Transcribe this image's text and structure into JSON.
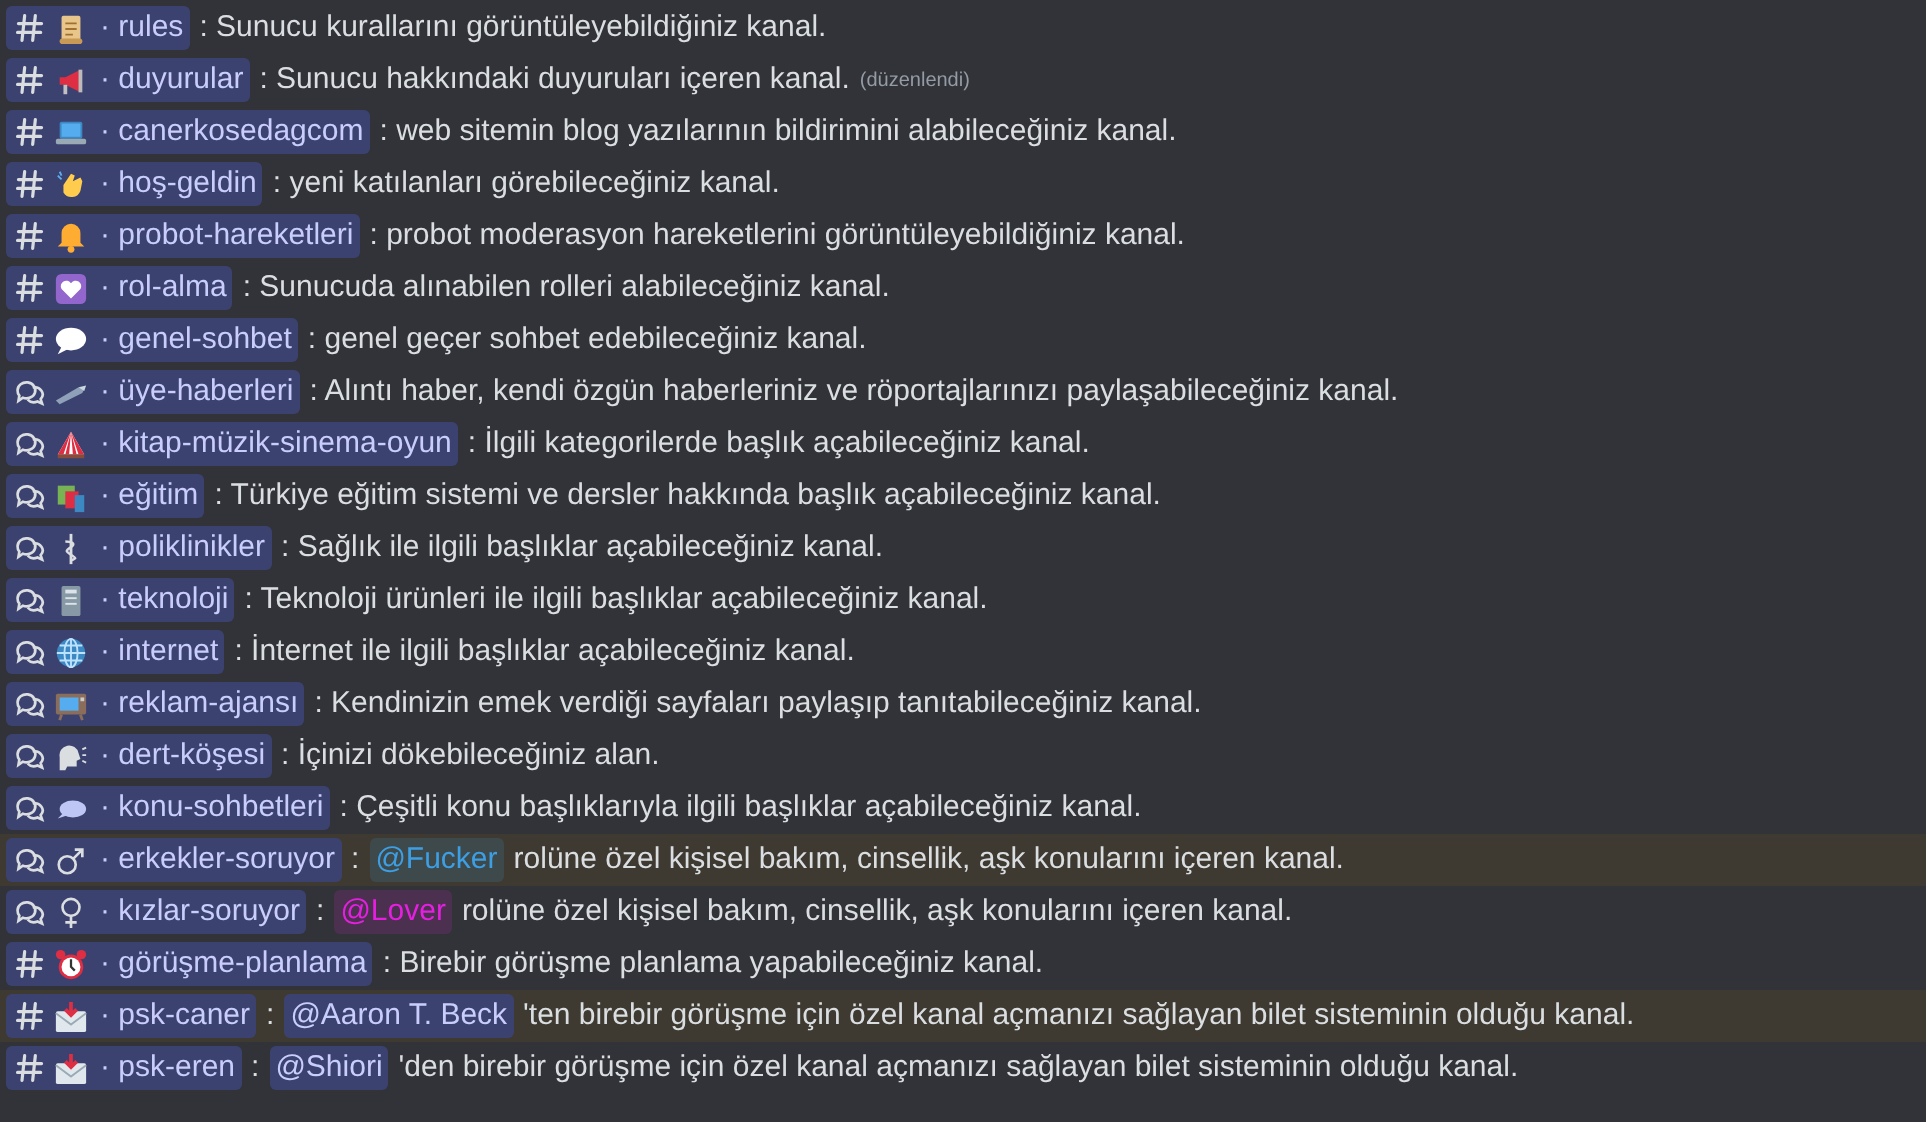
{
  "rows": [
    {
      "channel": {
        "kind": "text",
        "emoji": {
          "kind": "scroll"
        },
        "name": "· rules"
      },
      "parts": [
        {
          "kind": "text",
          "text": ": Sunucu kurallarını görüntüleyebildiğiniz kanal."
        }
      ],
      "highlighted": false
    },
    {
      "channel": {
        "kind": "text",
        "emoji": {
          "kind": "megaphone"
        },
        "name": "· duyurular"
      },
      "parts": [
        {
          "kind": "text",
          "text": ": Sunucu hakkındaki duyuruları içeren kanal."
        }
      ],
      "edited": "(düzenlendi)",
      "highlighted": false
    },
    {
      "channel": {
        "kind": "text",
        "emoji": {
          "kind": "laptop"
        },
        "name": "· canerkosedagcom"
      },
      "parts": [
        {
          "kind": "text",
          "text": ": web sitemin blog yazılarının bildirimini alabileceğiniz kanal."
        }
      ],
      "highlighted": false
    },
    {
      "channel": {
        "kind": "text",
        "emoji": {
          "kind": "hand"
        },
        "name": "· hoş-geldin"
      },
      "parts": [
        {
          "kind": "text",
          "text": ": yeni katılanları görebileceğiniz kanal."
        }
      ],
      "highlighted": false
    },
    {
      "channel": {
        "kind": "text",
        "emoji": {
          "kind": "bell"
        },
        "name": "· probot-hareketleri"
      },
      "parts": [
        {
          "kind": "text",
          "text": ": probot moderasyon hareketlerini görüntüleyebildiğiniz kanal."
        }
      ],
      "highlighted": false
    },
    {
      "channel": {
        "kind": "text",
        "emoji": {
          "kind": "heart"
        },
        "name": "· rol-alma"
      },
      "parts": [
        {
          "kind": "text",
          "text": ": Sunucuda alınabilen rolleri alabileceğiniz kanal."
        }
      ],
      "highlighted": false
    },
    {
      "channel": {
        "kind": "text",
        "emoji": {
          "kind": "speech"
        },
        "name": "· genel-sohbet"
      },
      "parts": [
        {
          "kind": "text",
          "text": ": genel geçer sohbet edebileceğiniz kanal."
        }
      ],
      "highlighted": false
    },
    {
      "channel": {
        "kind": "forum",
        "emoji": {
          "kind": "pen"
        },
        "name": "· üye-haberleri"
      },
      "parts": [
        {
          "kind": "text",
          "text": ": Alıntı haber, kendi özgün haberleriniz ve röportajlarınızı paylaşabileceğiniz kanal."
        }
      ],
      "highlighted": false
    },
    {
      "channel": {
        "kind": "forum",
        "emoji": {
          "kind": "tent"
        },
        "name": "· kitap-müzik-sinema-oyun"
      },
      "parts": [
        {
          "kind": "text",
          "text": ": İlgili kategorilerde başlık açabileceğiniz kanal."
        }
      ],
      "highlighted": false
    },
    {
      "channel": {
        "kind": "forum",
        "emoji": {
          "kind": "books"
        },
        "name": "· eğitim"
      },
      "parts": [
        {
          "kind": "text",
          "text": ": Türkiye eğitim sistemi ve dersler hakkında başlık açabileceğiniz kanal."
        }
      ],
      "highlighted": false
    },
    {
      "channel": {
        "kind": "forum",
        "emoji": {
          "kind": "medical"
        },
        "name": "· poliklinikler"
      },
      "parts": [
        {
          "kind": "text",
          "text": ": Sağlık ile ilgili başlıklar açabileceğiniz kanal."
        }
      ],
      "highlighted": false
    },
    {
      "channel": {
        "kind": "forum",
        "emoji": {
          "kind": "tower"
        },
        "name": "· teknoloji"
      },
      "parts": [
        {
          "kind": "text",
          "text": ": Teknoloji ürünleri ile ilgili başlıklar açabileceğiniz kanal."
        }
      ],
      "highlighted": false
    },
    {
      "channel": {
        "kind": "forum",
        "emoji": {
          "kind": "globe"
        },
        "name": "· internet"
      },
      "parts": [
        {
          "kind": "text",
          "text": ": İnternet ile ilgili başlıklar açabileceğiniz kanal."
        }
      ],
      "highlighted": false
    },
    {
      "channel": {
        "kind": "forum",
        "emoji": {
          "kind": "tv"
        },
        "name": "· reklam-ajansı"
      },
      "parts": [
        {
          "kind": "text",
          "text": ": Kendinizin emek verdiği sayfaları paylaşıp tanıtabileceğiniz kanal."
        }
      ],
      "highlighted": false
    },
    {
      "channel": {
        "kind": "forum",
        "emoji": {
          "kind": "head"
        },
        "name": "· dert-köşesi"
      },
      "parts": [
        {
          "kind": "text",
          "text": ": İçinizi dökebileceğiniz alan."
        }
      ],
      "highlighted": false
    },
    {
      "channel": {
        "kind": "forum",
        "emoji": {
          "kind": "balloon"
        },
        "name": "· konu-sohbetleri"
      },
      "parts": [
        {
          "kind": "text",
          "text": ": Çeşitli konu başlıklarıyla ilgili başlıklar açabileceğiniz kanal."
        }
      ],
      "highlighted": false
    },
    {
      "channel": {
        "kind": "forum",
        "emoji": {
          "kind": "male"
        },
        "name": "· erkekler-soruyor"
      },
      "parts": [
        {
          "kind": "text",
          "text": ":"
        },
        {
          "kind": "role",
          "text": "@Fucker",
          "color": "#3d9ee3"
        },
        {
          "kind": "text",
          "text": "rolüne özel kişisel bakım, cinsellik, aşk konularını içeren kanal."
        }
      ],
      "highlighted": true
    },
    {
      "channel": {
        "kind": "forum",
        "emoji": {
          "kind": "female"
        },
        "name": "· kızlar-soruyor"
      },
      "parts": [
        {
          "kind": "text",
          "text": ":"
        },
        {
          "kind": "role",
          "text": "@Lover",
          "color": "#e41fe0"
        },
        {
          "kind": "text",
          "text": "rolüne özel kişisel bakım, cinsellik, aşk konularını içeren kanal."
        }
      ],
      "highlighted": false
    },
    {
      "channel": {
        "kind": "text",
        "emoji": {
          "kind": "alarm"
        },
        "name": "· görüşme-planlama"
      },
      "parts": [
        {
          "kind": "text",
          "text": ": Birebir görüşme planlama yapabileceğiniz kanal."
        }
      ],
      "highlighted": false
    },
    {
      "channel": {
        "kind": "text",
        "emoji": {
          "kind": "envelope"
        },
        "name": "· psk-caner"
      },
      "parts": [
        {
          "kind": "text",
          "text": ":"
        },
        {
          "kind": "user",
          "text": "@Aaron T. Beck"
        },
        {
          "kind": "text",
          "text": "'ten birebir görüşme için özel kanal açmanızı sağlayan bilet sisteminin olduğu kanal."
        }
      ],
      "highlighted": true
    },
    {
      "channel": {
        "kind": "text",
        "emoji": {
          "kind": "envelope"
        },
        "name": "· psk-eren"
      },
      "parts": [
        {
          "kind": "text",
          "text": ":"
        },
        {
          "kind": "user",
          "text": "@Shiori"
        },
        {
          "kind": "text",
          "text": "'den birebir görüşme için özel kanal açmanızı sağlayan bilet sisteminin olduğu kanal."
        }
      ],
      "highlighted": false
    }
  ]
}
